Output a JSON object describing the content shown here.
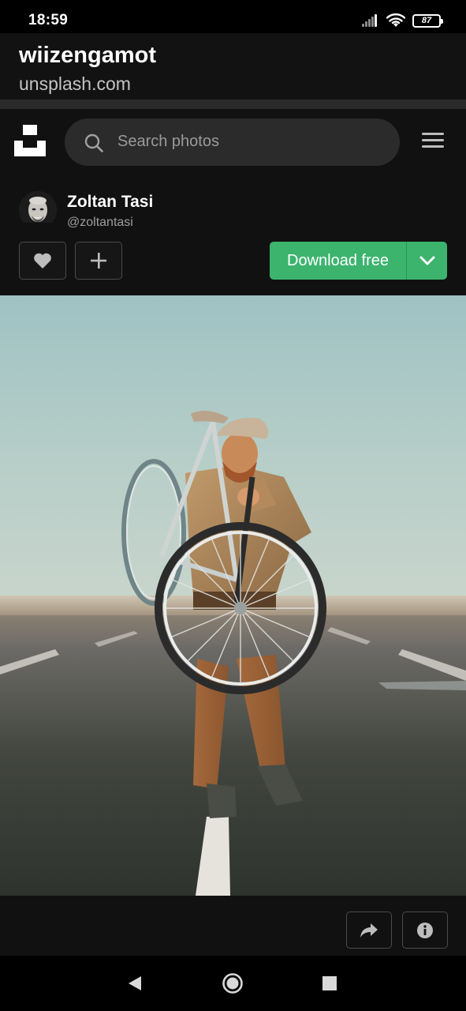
{
  "status_bar": {
    "time": "18:59",
    "battery": "87"
  },
  "browser": {
    "title": "wiizengamot",
    "url": "unsplash.com"
  },
  "header": {
    "search_placeholder": "Search photos"
  },
  "author": {
    "name": "Zoltan Tasi",
    "handle": "@zoltantasi"
  },
  "actions": {
    "download_label": "Download free"
  },
  "colors": {
    "accent_green": "#3cb46e",
    "background": "#111111",
    "search_bg": "#2b2b2b"
  },
  "icons": {
    "like": "heart-icon",
    "collect": "plus-icon",
    "download_options": "chevron-down-icon",
    "share": "share-icon",
    "info": "info-icon",
    "search": "search-icon",
    "menu": "hamburger-menu-icon"
  }
}
